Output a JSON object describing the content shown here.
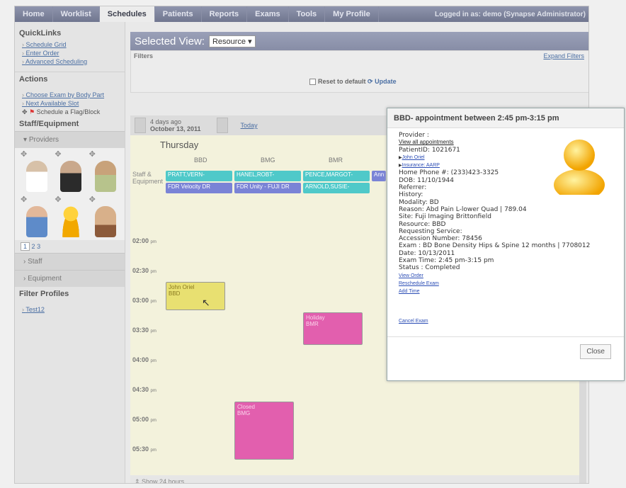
{
  "nav": {
    "tabs": [
      "Home",
      "Worklist",
      "Schedules",
      "Patients",
      "Reports",
      "Exams",
      "Tools",
      "My Profile"
    ],
    "active": "Schedules",
    "login": "Logged in as: demo (Synapse Administrator)"
  },
  "sidebar": {
    "quicklinks_title": "QuickLinks",
    "quicklinks": [
      "Schedule Grid",
      "Enter Order",
      "Advanced Scheduling"
    ],
    "actions_title": "Actions",
    "actions": [
      "Choose Exam by Body Part",
      "Next Available Slot"
    ],
    "flag_label": "Schedule a Flag/Block",
    "staff_title": "Staff/Equipment",
    "providers": "Providers",
    "pages": [
      "1",
      "2",
      "3"
    ],
    "staff": "Staff",
    "equipment": "Equipment",
    "filter_profiles_title": "Filter Profiles",
    "filter_profile": "Test12"
  },
  "main": {
    "selected_view": "Selected View:",
    "view_value": "Resource",
    "filters": "Filters",
    "expand_filters": "Expand Filters",
    "reset": "Reset to default",
    "update": "Update"
  },
  "calendar": {
    "prev_label": "4 days ago",
    "prev_date": "October 13, 2011",
    "today": "Today",
    "day": "Thursday",
    "columns": [
      "BBD",
      "BMG",
      "BMR"
    ],
    "staff_label": "Staff & Equipment",
    "chips": [
      "PRATT,VERN-",
      "HANEL,ROBT-",
      "PENCE,MARGOT-",
      "Ann",
      "FDR Velocity DR",
      "FDR Unity - FUJI DR",
      "ARNOLD,SUSIE-"
    ],
    "times": [
      "02:00",
      "02:30",
      "03:00",
      "03:30",
      "04:00",
      "04:30",
      "05:00",
      "05:30"
    ],
    "pm": "pm",
    "appointments": [
      {
        "name": "John Oriel",
        "resource": "BBD"
      },
      {
        "name": "Holiday",
        "resource": "BMR"
      },
      {
        "name": "Closed",
        "resource": "BMG"
      }
    ],
    "show24": "Show 24 hours..."
  },
  "popup": {
    "title": "BBD- appointment between 2:45 pm-3:15 pm",
    "provider": "Provider :",
    "view_all": "View all appointments",
    "patient_id": "PatientID: 1021671",
    "patient_link": "John Oriel",
    "insurance_link": "Insurance: AARP",
    "lines": [
      "Home Phone #: (233)423-3325",
      "DOB: 11/10/1944",
      "Referrer:",
      "History:",
      "Modality: BD",
      "Reason: Abd Pain L-lower Quad | 789.04",
      "Site: Fuji Imaging Brittonfield",
      "Resource: BBD",
      "Requesting Service:",
      "Accession Number: 78456",
      "Exam : BD Bone Density Hips & Spine 12 months | 7708012",
      "Date: 10/13/2011",
      "Exam Time: 2:45 pm-3:15 pm",
      "Status : Completed"
    ],
    "links": [
      "View Order",
      "Reschedule Exam",
      "Add Time"
    ],
    "cancel": "Cancel Exam",
    "close": "Close"
  },
  "colors": {
    "nav": "#7d839c",
    "chip_teal": "#4fc9c9",
    "chip_blue": "#7a83d6",
    "appt_yellow": "#e8e071",
    "appt_pink": "#e25fae"
  }
}
